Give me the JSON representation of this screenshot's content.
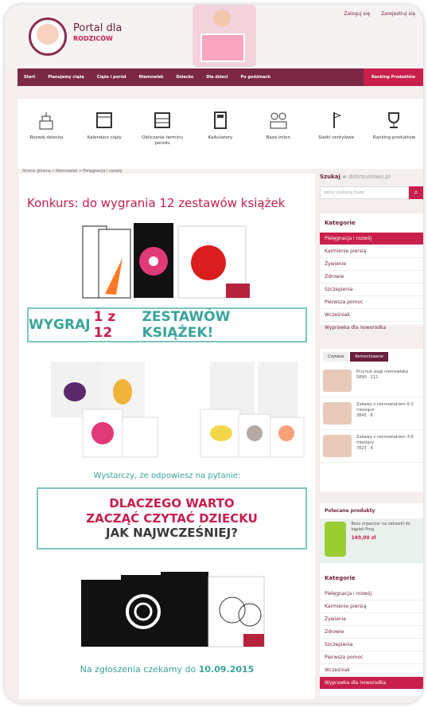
{
  "header": {
    "logo_line1": "Portal dla",
    "logo_line2": "RODZICÓW",
    "login": "Zaloguj się",
    "register": "Zarejestruj się"
  },
  "nav": {
    "items": [
      "Start",
      "Planujemy ciążę",
      "Ciąża i poród",
      "Niemowlak",
      "Dziecko",
      "Dla dzieci",
      "Po godzinach"
    ],
    "ranking": "Ranking Produktów"
  },
  "tools": [
    {
      "label": "Rozwój dziecka",
      "icon": "cake-icon"
    },
    {
      "label": "Kalendarz ciąży",
      "icon": "calendar-icon"
    },
    {
      "label": "Obliczanie terminu porodu",
      "icon": "abacus-icon"
    },
    {
      "label": "Kalkulatory",
      "icon": "calculator-icon"
    },
    {
      "label": "Baza imion",
      "icon": "names-icon"
    },
    {
      "label": "Siatki centylowe",
      "icon": "scale-icon"
    },
    {
      "label": "Ranking produktów",
      "icon": "trophy-icon"
    }
  ],
  "breadcrumb": "Strona główna » Niemowlak » Pielęgnacja i rozwój",
  "article": {
    "title": "Konkurs: do wygrania 12 zestawów książek",
    "banner_pre": "WYGRAJ",
    "banner_num1": "1 z 12",
    "banner_post": "ZESTAWÓW KSIĄŻEK!",
    "lead": "Wystarczy, że odpowiesz na pytanie:",
    "question_l1": "DLACZEGO WARTO",
    "question_l2": "ZACZĄĆ CZYTAĆ DZIECKU",
    "question_l3": "JAK NAJWCZEŚNIEJ?",
    "deadline_text": "Na zgłoszenia czekamy do",
    "deadline_date": "10.09.2015"
  },
  "sidebar": {
    "search_label": "Szukaj",
    "search_site": "w dobrzuslowo.pl",
    "search_placeholder": "wpisz szukaną frazę",
    "search_icon": "search-icon",
    "categories_title": "Kategorie",
    "categories": [
      "Pielęgnacja i rozwój",
      "Karmienie piersią",
      "Żywienie",
      "Zdrowie",
      "Szczepienia",
      "Pierwsza pomoc",
      "Wcześniak",
      "Wyprawka dla noworodka"
    ],
    "tab_read": "Czytane",
    "tab_comments": "Komentowane",
    "articles": [
      {
        "title": "Przyrost wagi niemowlaka",
        "meta": "5890 · 112"
      },
      {
        "title": "Zabawy z niemowlakiem 0-3 miesiące",
        "meta": "3845 · 8"
      },
      {
        "title": "Zabawy z niemowlakiem 3-6 miesięcy",
        "meta": "7823 · 4"
      }
    ],
    "product_title": "Polecane produkty",
    "product_name": "Boss organizer na zabawki do kąpieli Frog",
    "product_price": "149,00 zł",
    "categories2": [
      "Pielęgnacja i rozwój",
      "Karmienie piersią",
      "Żywienie",
      "Zdrowie",
      "Szczepienia",
      "Pierwsza pomoc",
      "Wcześniak",
      "Wyprawka dla noworodka"
    ]
  }
}
